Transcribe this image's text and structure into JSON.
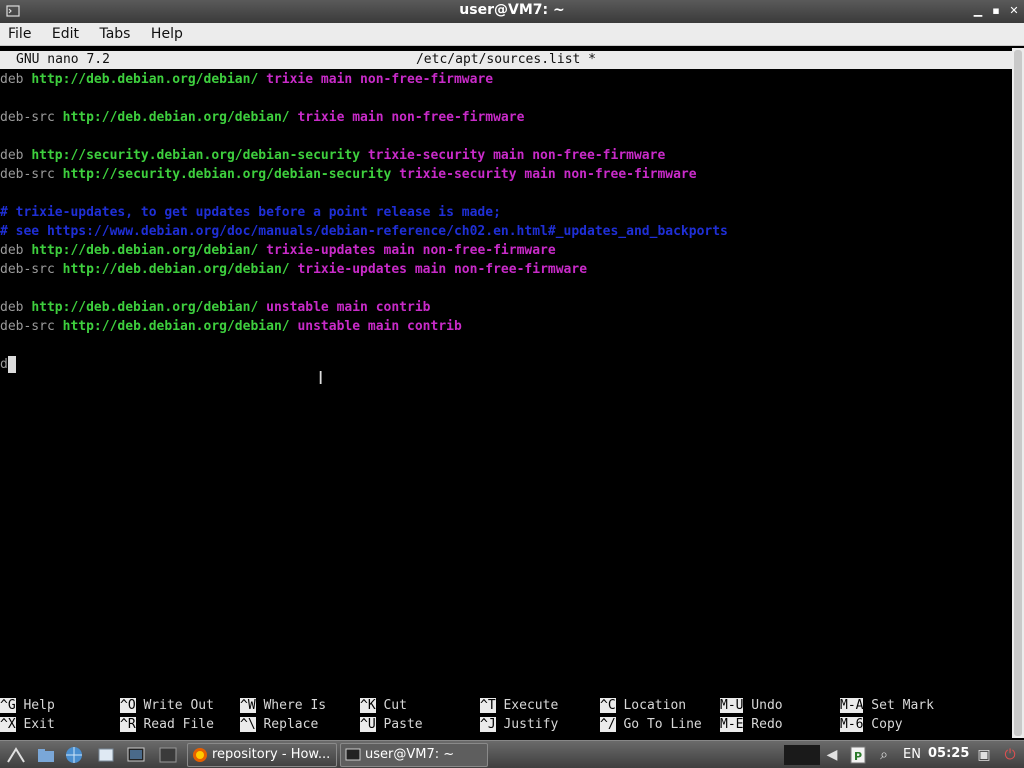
{
  "window": {
    "title": "user@VM7: ~"
  },
  "menu": {
    "file": "File",
    "edit": "Edit",
    "tabs": "Tabs",
    "help": "Help"
  },
  "nano": {
    "version": "GNU nano 7.2",
    "filename": "/etc/apt/sources.list *"
  },
  "editor_lines": [
    [
      [
        "kw",
        "deb "
      ],
      [
        "url",
        "http://deb.debian.org/debian/ "
      ],
      [
        "suite",
        "trixie main non-free-firmware"
      ]
    ],
    [],
    [
      [
        "kw",
        "deb-src "
      ],
      [
        "url",
        "http://deb.debian.org/debian/ "
      ],
      [
        "suite",
        "trixie main non-free-firmware"
      ]
    ],
    [],
    [
      [
        "kw",
        "deb "
      ],
      [
        "url",
        "http://security.debian.org/debian-security "
      ],
      [
        "suite",
        "trixie-security main non-free-firmware"
      ]
    ],
    [
      [
        "kw",
        "deb-src "
      ],
      [
        "url",
        "http://security.debian.org/debian-security "
      ],
      [
        "suite",
        "trixie-security main non-free-firmware"
      ]
    ],
    [],
    [
      [
        "cmt",
        "# trixie-updates, to get updates before a point release is made;"
      ]
    ],
    [
      [
        "cmt",
        "# see https://www.debian.org/doc/manuals/debian-reference/ch02.en.html#_updates_and_backports"
      ]
    ],
    [
      [
        "kw",
        "deb "
      ],
      [
        "url",
        "http://deb.debian.org/debian/ "
      ],
      [
        "suite",
        "trixie-updates main non-free-firmware"
      ]
    ],
    [
      [
        "kw",
        "deb-src "
      ],
      [
        "url",
        "http://deb.debian.org/debian/ "
      ],
      [
        "suite",
        "trixie-updates main non-free-firmware"
      ]
    ],
    [],
    [
      [
        "kw",
        "deb "
      ],
      [
        "url",
        "http://deb.debian.org/debian/ "
      ],
      [
        "suite",
        "unstable main contrib"
      ]
    ],
    [
      [
        "kw",
        "deb-src "
      ],
      [
        "url",
        "http://deb.debian.org/debian/ "
      ],
      [
        "suite",
        "unstable main contrib"
      ]
    ],
    [],
    [
      [
        "kw",
        "d"
      ],
      [
        "cursor",
        ""
      ]
    ]
  ],
  "shortcuts": [
    {
      "key": "^G",
      "label": "Help"
    },
    {
      "key": "^X",
      "label": "Exit"
    },
    {
      "key": "^O",
      "label": "Write Out"
    },
    {
      "key": "^R",
      "label": "Read File"
    },
    {
      "key": "^W",
      "label": "Where Is"
    },
    {
      "key": "^\\",
      "label": "Replace"
    },
    {
      "key": "^K",
      "label": "Cut"
    },
    {
      "key": "^U",
      "label": "Paste"
    },
    {
      "key": "^T",
      "label": "Execute"
    },
    {
      "key": "^J",
      "label": "Justify"
    },
    {
      "key": "^C",
      "label": "Location"
    },
    {
      "key": "^/",
      "label": "Go To Line"
    },
    {
      "key": "M-U",
      "label": "Undo"
    },
    {
      "key": "M-E",
      "label": "Redo"
    },
    {
      "key": "M-A",
      "label": "Set Mark"
    },
    {
      "key": "M-6",
      "label": "Copy"
    }
  ],
  "taskbar": {
    "task_browser": "repository - How...",
    "task_terminal": "user@VM7: ~",
    "language": "EN",
    "clock": "05:25"
  },
  "colors": {
    "url": "#3ecf3e",
    "suite": "#c92bc9",
    "comment": "#1f2fd6",
    "keyword": "#9b9b9b"
  }
}
